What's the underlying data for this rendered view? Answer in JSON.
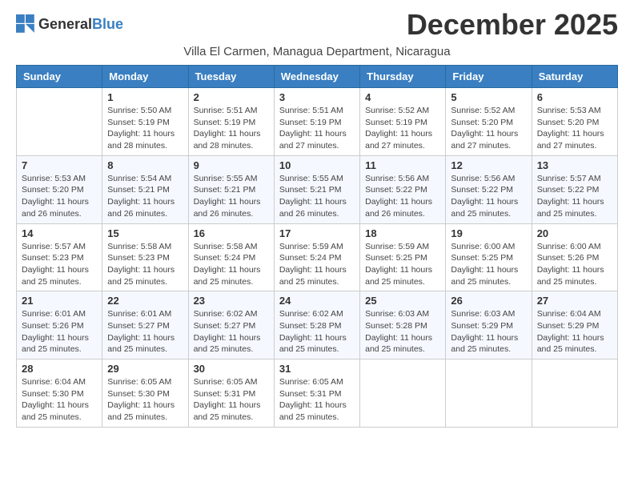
{
  "logo": {
    "general": "General",
    "blue": "Blue"
  },
  "title": "December 2025",
  "subtitle": "Villa El Carmen, Managua Department, Nicaragua",
  "weekdays": [
    "Sunday",
    "Monday",
    "Tuesday",
    "Wednesday",
    "Thursday",
    "Friday",
    "Saturday"
  ],
  "weeks": [
    [
      {
        "day": "",
        "info": ""
      },
      {
        "day": "1",
        "info": "Sunrise: 5:50 AM\nSunset: 5:19 PM\nDaylight: 11 hours\nand 28 minutes."
      },
      {
        "day": "2",
        "info": "Sunrise: 5:51 AM\nSunset: 5:19 PM\nDaylight: 11 hours\nand 28 minutes."
      },
      {
        "day": "3",
        "info": "Sunrise: 5:51 AM\nSunset: 5:19 PM\nDaylight: 11 hours\nand 27 minutes."
      },
      {
        "day": "4",
        "info": "Sunrise: 5:52 AM\nSunset: 5:19 PM\nDaylight: 11 hours\nand 27 minutes."
      },
      {
        "day": "5",
        "info": "Sunrise: 5:52 AM\nSunset: 5:20 PM\nDaylight: 11 hours\nand 27 minutes."
      },
      {
        "day": "6",
        "info": "Sunrise: 5:53 AM\nSunset: 5:20 PM\nDaylight: 11 hours\nand 27 minutes."
      }
    ],
    [
      {
        "day": "7",
        "info": "Sunrise: 5:53 AM\nSunset: 5:20 PM\nDaylight: 11 hours\nand 26 minutes."
      },
      {
        "day": "8",
        "info": "Sunrise: 5:54 AM\nSunset: 5:21 PM\nDaylight: 11 hours\nand 26 minutes."
      },
      {
        "day": "9",
        "info": "Sunrise: 5:55 AM\nSunset: 5:21 PM\nDaylight: 11 hours\nand 26 minutes."
      },
      {
        "day": "10",
        "info": "Sunrise: 5:55 AM\nSunset: 5:21 PM\nDaylight: 11 hours\nand 26 minutes."
      },
      {
        "day": "11",
        "info": "Sunrise: 5:56 AM\nSunset: 5:22 PM\nDaylight: 11 hours\nand 26 minutes."
      },
      {
        "day": "12",
        "info": "Sunrise: 5:56 AM\nSunset: 5:22 PM\nDaylight: 11 hours\nand 25 minutes."
      },
      {
        "day": "13",
        "info": "Sunrise: 5:57 AM\nSunset: 5:22 PM\nDaylight: 11 hours\nand 25 minutes."
      }
    ],
    [
      {
        "day": "14",
        "info": "Sunrise: 5:57 AM\nSunset: 5:23 PM\nDaylight: 11 hours\nand 25 minutes."
      },
      {
        "day": "15",
        "info": "Sunrise: 5:58 AM\nSunset: 5:23 PM\nDaylight: 11 hours\nand 25 minutes."
      },
      {
        "day": "16",
        "info": "Sunrise: 5:58 AM\nSunset: 5:24 PM\nDaylight: 11 hours\nand 25 minutes."
      },
      {
        "day": "17",
        "info": "Sunrise: 5:59 AM\nSunset: 5:24 PM\nDaylight: 11 hours\nand 25 minutes."
      },
      {
        "day": "18",
        "info": "Sunrise: 5:59 AM\nSunset: 5:25 PM\nDaylight: 11 hours\nand 25 minutes."
      },
      {
        "day": "19",
        "info": "Sunrise: 6:00 AM\nSunset: 5:25 PM\nDaylight: 11 hours\nand 25 minutes."
      },
      {
        "day": "20",
        "info": "Sunrise: 6:00 AM\nSunset: 5:26 PM\nDaylight: 11 hours\nand 25 minutes."
      }
    ],
    [
      {
        "day": "21",
        "info": "Sunrise: 6:01 AM\nSunset: 5:26 PM\nDaylight: 11 hours\nand 25 minutes."
      },
      {
        "day": "22",
        "info": "Sunrise: 6:01 AM\nSunset: 5:27 PM\nDaylight: 11 hours\nand 25 minutes."
      },
      {
        "day": "23",
        "info": "Sunrise: 6:02 AM\nSunset: 5:27 PM\nDaylight: 11 hours\nand 25 minutes."
      },
      {
        "day": "24",
        "info": "Sunrise: 6:02 AM\nSunset: 5:28 PM\nDaylight: 11 hours\nand 25 minutes."
      },
      {
        "day": "25",
        "info": "Sunrise: 6:03 AM\nSunset: 5:28 PM\nDaylight: 11 hours\nand 25 minutes."
      },
      {
        "day": "26",
        "info": "Sunrise: 6:03 AM\nSunset: 5:29 PM\nDaylight: 11 hours\nand 25 minutes."
      },
      {
        "day": "27",
        "info": "Sunrise: 6:04 AM\nSunset: 5:29 PM\nDaylight: 11 hours\nand 25 minutes."
      }
    ],
    [
      {
        "day": "28",
        "info": "Sunrise: 6:04 AM\nSunset: 5:30 PM\nDaylight: 11 hours\nand 25 minutes."
      },
      {
        "day": "29",
        "info": "Sunrise: 6:05 AM\nSunset: 5:30 PM\nDaylight: 11 hours\nand 25 minutes."
      },
      {
        "day": "30",
        "info": "Sunrise: 6:05 AM\nSunset: 5:31 PM\nDaylight: 11 hours\nand 25 minutes."
      },
      {
        "day": "31",
        "info": "Sunrise: 6:05 AM\nSunset: 5:31 PM\nDaylight: 11 hours\nand 25 minutes."
      },
      {
        "day": "",
        "info": ""
      },
      {
        "day": "",
        "info": ""
      },
      {
        "day": "",
        "info": ""
      }
    ]
  ]
}
